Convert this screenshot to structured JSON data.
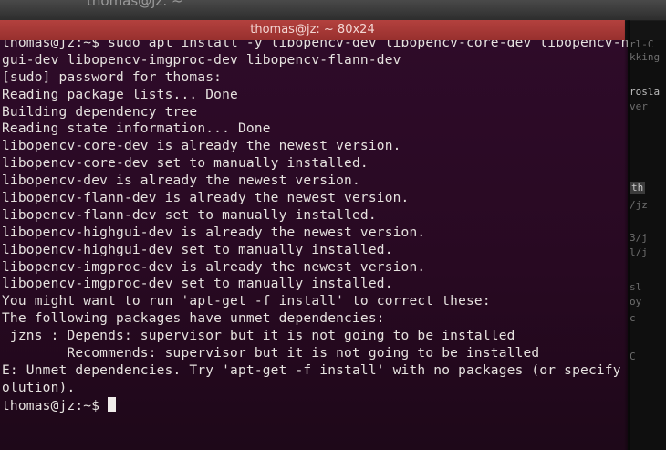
{
  "background_window": {
    "title": "thomas@jz: ~"
  },
  "terminal": {
    "title": "thomas@jz: ~ 80x24",
    "lines": [
      "thomas@jz:~$ sudo apt install -y libopencv-dev libopencv-core-dev libopencv-high",
      "gui-dev libopencv-imgproc-dev libopencv-flann-dev",
      "[sudo] password for thomas:",
      "Reading package lists... Done",
      "Building dependency tree",
      "Reading state information... Done",
      "libopencv-core-dev is already the newest version.",
      "libopencv-core-dev set to manually installed.",
      "libopencv-dev is already the newest version.",
      "libopencv-flann-dev is already the newest version.",
      "libopencv-flann-dev set to manually installed.",
      "libopencv-highgui-dev is already the newest version.",
      "libopencv-highgui-dev set to manually installed.",
      "libopencv-imgproc-dev is already the newest version.",
      "libopencv-imgproc-dev set to manually installed.",
      "You might want to run 'apt-get -f install' to correct these:",
      "The following packages have unmet dependencies:",
      " jzns : Depends: supervisor but it is not going to be installed",
      "        Recommends: supervisor but it is not going to be installed",
      "E: Unmet dependencies. Try 'apt-get -f install' with no packages (or specify a s",
      "olution).",
      "thomas@jz:~$ "
    ],
    "colors": {
      "background": "#2b0a26",
      "text": "#e6e2df",
      "titlebar": "#a8383a"
    }
  },
  "side_window": {
    "fragments": [
      "rl-C",
      "kking",
      "rosla",
      "ver",
      "th",
      "/jz",
      "3/j",
      "l/j",
      "sl",
      "oy",
      "c",
      "C"
    ]
  }
}
